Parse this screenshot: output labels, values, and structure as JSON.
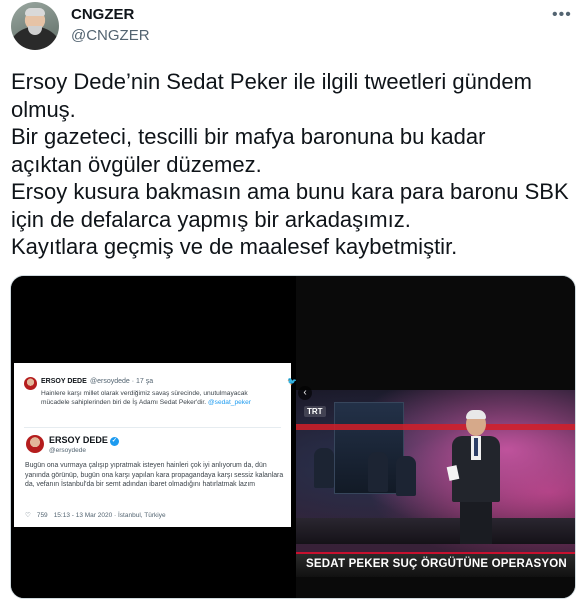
{
  "tweet": {
    "display_name": "CNGZER",
    "handle": "@CNGZER",
    "more_icon": "more-horizontal-icon",
    "text_lines": [
      "Ersoy Dede’nin Sedat Peker ile ilgili tweetleri gündem",
      "olmuş.",
      "Bir gazeteci, tescilli bir mafya baronuna bu kadar",
      "açıktan övgüler düzemez.",
      "Ersoy kusura bakmasın ama bunu kara para baronu SBK",
      "için de defalarca yapmış bir arkadaşımız.",
      "Kayıtlara geçmiş ve de maalesef kaybetmiştir."
    ]
  },
  "media_left": {
    "quoted": {
      "name": "ERSOY DEDE",
      "handle": "@ersoydede · 17 şa",
      "body": "Hainlere karşı millet olarak verdiğimiz savaş sürecinde, unutulmayacak mücadele sahiplerinden biri de İş Adamı Sedat Peker'dir.",
      "mention": "@sedat_peker"
    },
    "embedded": {
      "name": "ERSOY DEDE",
      "handle": "@ersoydede",
      "body": "Bugün ona vurmaya çalışıp yıpratmak isteyen hainleri çok iyi anlıyorum da, dün yanında görünüp, bugün ona karşı yapılan kara propagandaya karşı sessiz kalanlara da, vefanın İstanbul'da bir semt adından ibaret olmadığını hatırlatmak lazım",
      "likes": "759",
      "timestamp": "15:13 - 13 Mar 2020 · İstanbul, Türkiye"
    }
  },
  "media_right": {
    "channel": "TRT",
    "chyron": "SEDAT PEKER SUÇ ÖRGÜTÜNE OPERASYON"
  },
  "colors": {
    "text": "#0f1419",
    "muted": "#536471",
    "link": "#1d9bf0",
    "chyron_red": "#c8102e"
  }
}
